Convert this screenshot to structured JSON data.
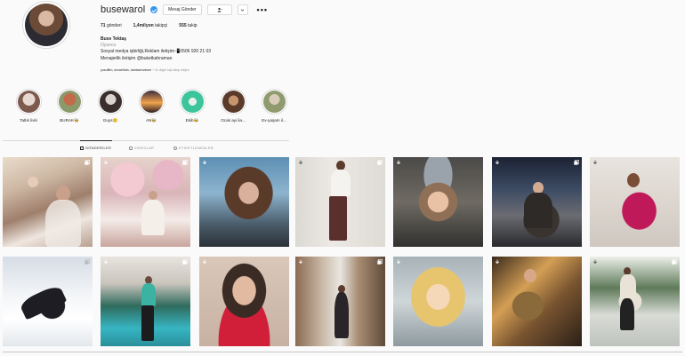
{
  "profile": {
    "username": "busewarol",
    "message_button": "Mesaj Gönder",
    "follow_icon": "person-check-icon",
    "chevron_icon": "chevron-down-icon",
    "more_icon": "ellipsis-icon",
    "more_text": "•••",
    "stats": {
      "posts_count": "71",
      "posts_label": "gönderi",
      "followers_count": "1,4milyon",
      "followers_label": "takipçi",
      "following_count": "555",
      "following_label": "takip"
    },
    "bio": {
      "name": "Buse Tektaş",
      "category": "Oyuncu",
      "line1": "Sosyal medya işbirliği,Reklam iletişim📲0506 920 21 03",
      "line2": "Menajerlik iletişim @buketkahraman"
    },
    "followed_by_names": "yusufflm, sevaeflatn, damlaenvdsee",
    "followed_by_more": "+ 41 diğer kişi takip ediyor"
  },
  "highlights": [
    {
      "label": "Tatlık livki",
      "colors": [
        "#e8d8d2",
        "#7c5a4e"
      ]
    },
    {
      "label": "BURAK🐝",
      "colors": [
        "#c26b4a",
        "#8a9a6b"
      ]
    },
    {
      "label": "Guys😊",
      "colors": [
        "#d9d4cf",
        "#3a2f2d"
      ]
    },
    {
      "label": "AN🐝",
      "colors": [
        "#f1a34d",
        "#3a2a3e"
      ]
    },
    {
      "label": "Ekib🐝",
      "colors": [
        "#3cc49b",
        "#e9efe9"
      ]
    },
    {
      "label": "Ocak ayi ila...",
      "colors": [
        "#c7956d",
        "#5a3a2a"
      ]
    },
    {
      "label": "Ev-yaşam il...",
      "colors": [
        "#8f9b6e",
        "#d9cdb9"
      ]
    }
  ],
  "tabs": [
    {
      "label": "GÖNDERİLER",
      "icon": "grid-icon"
    },
    {
      "label": "VİDEOLAR",
      "icon": "video-icon"
    },
    {
      "label": "ETİKETLENENLER",
      "icon": "tag-icon"
    }
  ],
  "posts": [
    {
      "label": "post-1",
      "icons": [
        "multi-photo-icon"
      ]
    },
    {
      "label": "post-2",
      "icons": [
        "download-icon",
        "multi-photo-icon"
      ]
    },
    {
      "label": "post-3",
      "icons": [
        "download-icon"
      ]
    },
    {
      "label": "post-4",
      "icons": [
        "download-icon",
        "multi-photo-icon"
      ]
    },
    {
      "label": "post-5",
      "icons": [
        "download-icon"
      ]
    },
    {
      "label": "post-6",
      "icons": [
        "download-icon",
        "multi-photo-icon"
      ]
    },
    {
      "label": "post-7",
      "icons": [
        "download-icon"
      ]
    },
    {
      "label": "post-8",
      "icons": [
        "download-icon"
      ]
    },
    {
      "label": "post-9",
      "icons": [
        "download-icon",
        "multi-photo-icon"
      ]
    },
    {
      "label": "post-10",
      "icons": [
        "download-icon"
      ]
    },
    {
      "label": "post-11",
      "icons": [
        "download-icon",
        "multi-photo-icon"
      ]
    },
    {
      "label": "post-12",
      "icons": [
        "download-icon"
      ]
    },
    {
      "label": "post-13",
      "icons": [
        "download-icon"
      ]
    },
    {
      "label": "post-14",
      "icons": [
        "download-icon",
        "multi-photo-icon"
      ]
    }
  ],
  "colors": {
    "verified": "#3897f0",
    "text": "#262626",
    "muted": "#8e8e8e",
    "border": "#dbdbdb"
  }
}
